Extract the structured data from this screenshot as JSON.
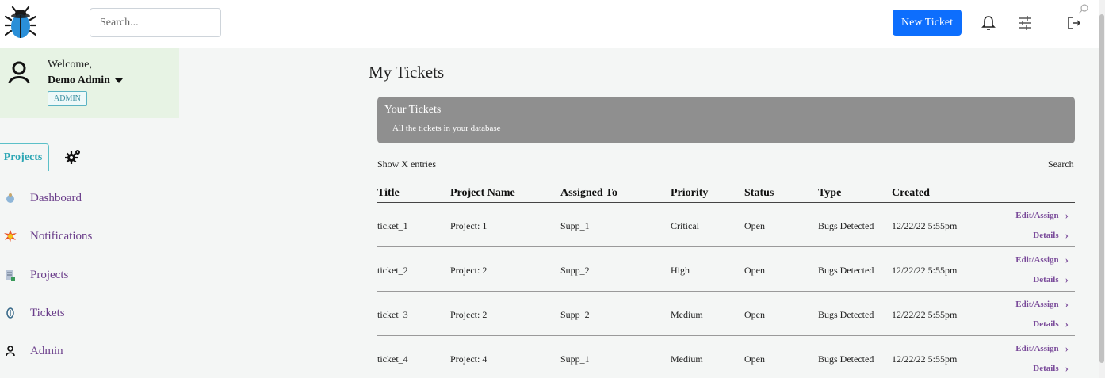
{
  "topbar": {
    "search_placeholder": "Search...",
    "new_ticket_label": "New Ticket"
  },
  "user": {
    "welcome": "Welcome,",
    "name": "Demo Admin",
    "role": "ADMIN"
  },
  "sidebar": {
    "tab_projects": "Projects",
    "items": [
      {
        "label": "Dashboard",
        "icon": "dashboard-icon"
      },
      {
        "label": "Notifications",
        "icon": "notifications-icon"
      },
      {
        "label": "Projects",
        "icon": "projects-icon"
      },
      {
        "label": "Tickets",
        "icon": "tickets-icon"
      },
      {
        "label": "Admin",
        "icon": "admin-icon"
      }
    ]
  },
  "main": {
    "title": "My Tickets",
    "banner_title": "Your Tickets",
    "banner_subtitle": "All the tickets in your database",
    "show_entries": "Show X entries",
    "search_label": "Search",
    "columns": [
      "Title",
      "Project Name",
      "Assigned To",
      "Priority",
      "Status",
      "Type",
      "Created"
    ],
    "edit_label": "Edit/Assign",
    "details_label": "Details",
    "rows": [
      {
        "title": "ticket_1",
        "project": "Project: 1",
        "assigned": "Supp_1",
        "priority": "Critical",
        "status": "Open",
        "type": "Bugs Detected",
        "created": "12/22/22 5:55pm"
      },
      {
        "title": "ticket_2",
        "project": "Project: 2",
        "assigned": "Supp_2",
        "priority": "High",
        "status": "Open",
        "type": "Bugs Detected",
        "created": "12/22/22 5:55pm"
      },
      {
        "title": "ticket_3",
        "project": "Project: 2",
        "assigned": "Supp_2",
        "priority": "Medium",
        "status": "Open",
        "type": "Bugs Detected",
        "created": "12/22/22 5:55pm"
      },
      {
        "title": "ticket_4",
        "project": "Project: 4",
        "assigned": "Supp_1",
        "priority": "Medium",
        "status": "Open",
        "type": "Bugs Detected",
        "created": "12/22/22 5:55pm"
      }
    ]
  },
  "colors": {
    "accent": "#0d6efd",
    "link_purple": "#6a3d8a",
    "welcome_bg": "#e7f3e4",
    "banner_bg": "#8f8f8f"
  }
}
